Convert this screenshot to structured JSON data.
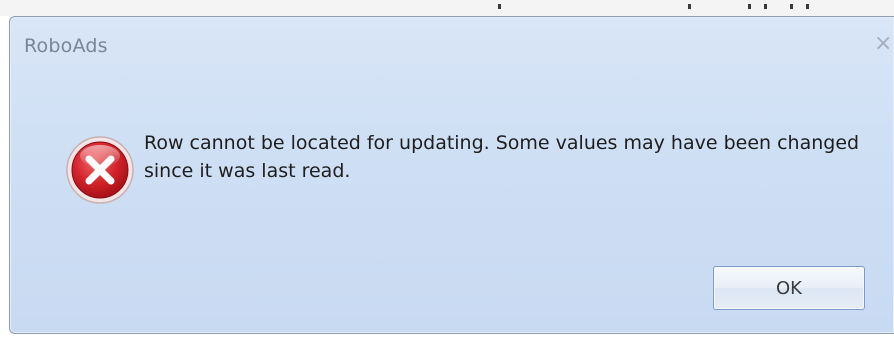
{
  "dialog": {
    "title": "RoboAds",
    "close_glyph": "×",
    "message": "Row cannot be located for updating. Some values may have been changed since it was last read.",
    "icon": "error-icon",
    "ok_label": "OK"
  },
  "colors": {
    "dialog_bg": "#cfdff4",
    "title_text": "#7a8596",
    "icon_red": "#c8161c",
    "button_border": "#7f9cc9"
  }
}
